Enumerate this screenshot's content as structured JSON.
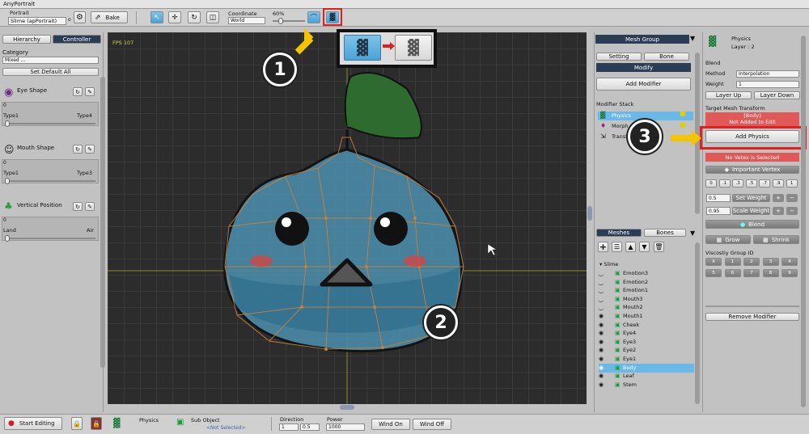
{
  "window": {
    "title": "AnyPortrait"
  },
  "toolbar": {
    "portrait_label": "Portrait",
    "portrait_value": "Slime (apPortrait)",
    "bake_label": "Bake",
    "coordinate_label": "Coordinate",
    "coordinate_value": "World",
    "zoom_value": "60%"
  },
  "left": {
    "tabs": [
      "Hierarchy",
      "Controller"
    ],
    "category_label": "Category",
    "category_value": "Mixed ...",
    "set_default_label": "Set Default All",
    "controllers": [
      {
        "name": "Eye Shape",
        "value": "0",
        "min": "Type1",
        "max": "Type4"
      },
      {
        "name": "Mouth Shape",
        "value": "0",
        "min": "Type1",
        "max": "Type3"
      },
      {
        "name": "Vertical Position",
        "value": "0",
        "min": "Land",
        "max": "Air"
      }
    ]
  },
  "canvas": {
    "fps": "FPS 107"
  },
  "callouts": [
    "1",
    "2",
    "3"
  ],
  "mesh_panel": {
    "header": "Mesh Group",
    "setting_tab": "Setting",
    "bone_tab": "Bone",
    "modify_label": "Modify",
    "add_modifier_label": "Add Modifier",
    "modifier_stack_label": "Modifier Stack",
    "modifiers": [
      "Physics",
      "Morph",
      "Transform (Anim)"
    ],
    "meshes_tab": "Meshes",
    "bones_tab": "Bones",
    "root_label": "Slime",
    "items": [
      "Emotion3",
      "Emotion2",
      "Emotion1",
      "Mouth3",
      "Mouth2",
      "Mouth1",
      "Cheek",
      "Eye4",
      "Eye3",
      "Eye2",
      "Eye1",
      "Body",
      "Leaf",
      "Stem"
    ],
    "selected_item": "Body"
  },
  "right": {
    "modifier_name": "Physics",
    "layer_label": "Layer : 2",
    "blend_label": "Blend",
    "method_label": "Method",
    "method_value": "Interpolation",
    "weight_label": "Weight",
    "weight_value": "1",
    "layer_up_label": "Layer Up",
    "layer_down_label": "Layer Down",
    "target_label": "Target Mesh Transform",
    "target_value": "[Body]",
    "target_sub": "Not Added to Edit",
    "add_physics_label": "Add Physics",
    "no_vertex_label": "No Vetex is Selected",
    "important_vertex_label": "Important Vertex",
    "weight_buttons": [
      "0",
      ".1",
      ".3",
      ".5",
      ".7",
      ".9",
      "1"
    ],
    "set_weight_value": "0.5",
    "set_weight_label": "Set Weight",
    "scale_weight_value": "0.95",
    "scale_weight_label": "Scale Weight",
    "blend_btn_label": "Blend",
    "grow_label": "Grow",
    "shrink_label": "Shrink",
    "viscosity_label": "Viscostiy Group ID",
    "viscosity_ids": [
      "X",
      "1",
      "2",
      "3",
      "4",
      "5",
      "6",
      "7",
      "8",
      "9"
    ],
    "remove_modifier_label": "Remove Modifier"
  },
  "bottom": {
    "start_editing_label": "Start Editing",
    "physics_label": "Physics",
    "sub_object_label": "Sub Object",
    "not_selected_label": "<Not Selected>",
    "direction_label": "Direction",
    "direction_x": "1",
    "direction_y": "0.5",
    "power_label": "Power",
    "power_value": "1000",
    "wind_on_label": "Wind On",
    "wind_off_label": "Wind Off"
  },
  "colors": {
    "accent": "#4aa3d8",
    "highlight_red": "#e02020",
    "arrow_yellow": "#f5c400",
    "warn_bg": "#e05858"
  }
}
